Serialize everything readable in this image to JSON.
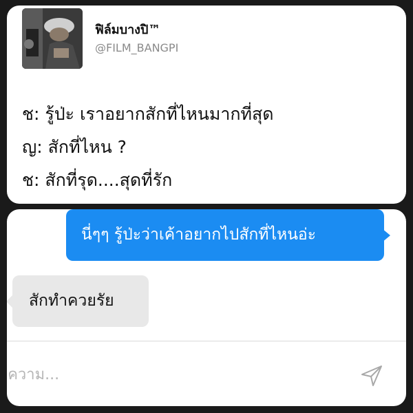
{
  "tweet": {
    "display_name": "ฟิล์มบางปิ™",
    "handle": "@FILM_BANGPI",
    "lines": [
      "ช: รู้ป่ะ เราอยากสักที่ไหนมากที่สุด",
      "ญ: สักที่ไหน ?",
      "ช: สักที่รุด....สุดที่รัก"
    ]
  },
  "chat": {
    "outgoing_message": "นี่ๆๆ รู้ป่ะว่าเค้าอยากไปสักที่ไหนอ่ะ",
    "incoming_message": "สักทำควยรัย",
    "compose_placeholder": "อความ...",
    "send_icon": "send-arrow-icon"
  },
  "colors": {
    "outgoing_bubble": "#1b8cf2",
    "incoming_bubble": "#e8e8e8",
    "background": "#1a1a1a"
  }
}
